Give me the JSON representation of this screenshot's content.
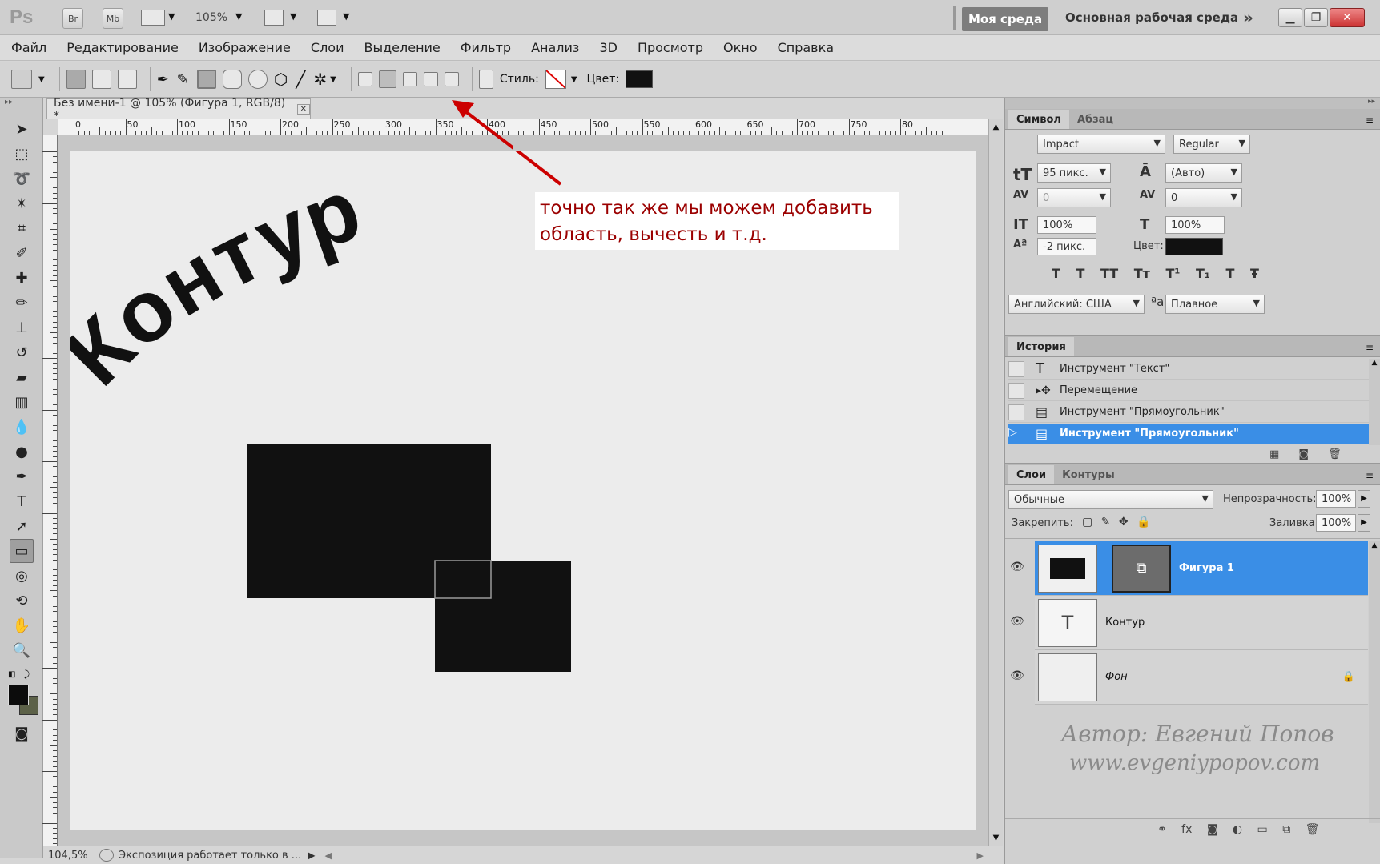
{
  "app": {
    "logo": "Ps",
    "bridge": "Br",
    "mini_bridge": "Mb",
    "zoom": "105%",
    "workspace_active": "Моя среда",
    "workspace_main": "Основная рабочая среда"
  },
  "menu": [
    "Файл",
    "Редактирование",
    "Изображение",
    "Слои",
    "Выделение",
    "Фильтр",
    "Анализ",
    "3D",
    "Просмотр",
    "Окно",
    "Справка"
  ],
  "options": {
    "style_label": "Стиль:",
    "color_label": "Цвет:",
    "color": "#111111"
  },
  "document": {
    "tab_title": "Без имени-1 @ 105% (Фигура 1, RGB/8) *",
    "ruler_ticks": [
      "0",
      "50",
      "100",
      "150",
      "200",
      "250",
      "300",
      "350",
      "400",
      "450",
      "500",
      "550",
      "600",
      "650",
      "700",
      "750",
      "80"
    ],
    "art_text": "Контур",
    "annotation_line1": "точно так же мы можем добавить",
    "annotation_line2": "область, вычесть и т.д.",
    "annotation_color": "#9b0000",
    "zoom_status": "104,5%",
    "status_text": "Экспозиция работает только в ..."
  },
  "character": {
    "tab_symbol": "Символ",
    "tab_paragraph": "Абзац",
    "font": "Impact",
    "style": "Regular",
    "size": "95 пикс.",
    "leading": "(Авто)",
    "kerning": "0",
    "tracking": "0",
    "vscale": "100%",
    "hscale": "100%",
    "baseline": "-2 пикс.",
    "color_label": "Цвет:",
    "language": "Английский: США",
    "aa_icon": "ªa",
    "antialias": "Плавное"
  },
  "history": {
    "title": "История",
    "items": [
      {
        "icon": "T",
        "label": "Инструмент \"Текст\""
      },
      {
        "icon": "▸✥",
        "label": "Перемещение"
      },
      {
        "icon": "▤",
        "label": "Инструмент \"Прямоугольник\""
      },
      {
        "icon": "▤",
        "label": "Инструмент \"Прямоугольник\""
      }
    ]
  },
  "layers": {
    "tab_layers": "Слои",
    "tab_paths": "Контуры",
    "blend_mode": "Обычные",
    "opacity_label": "Непрозрачность:",
    "opacity": "100%",
    "lock_label": "Закрепить:",
    "fill_label": "Заливка:",
    "fill": "100%",
    "items": [
      {
        "name": "Фигура 1",
        "type": "shape",
        "selected": true
      },
      {
        "name": "Контур",
        "type": "text",
        "selected": false
      },
      {
        "name": "Фон",
        "type": "background",
        "selected": false
      }
    ]
  },
  "watermark": {
    "line1": "Автор: Евгений Попов",
    "line2": "www.evgeniypopov.com"
  }
}
